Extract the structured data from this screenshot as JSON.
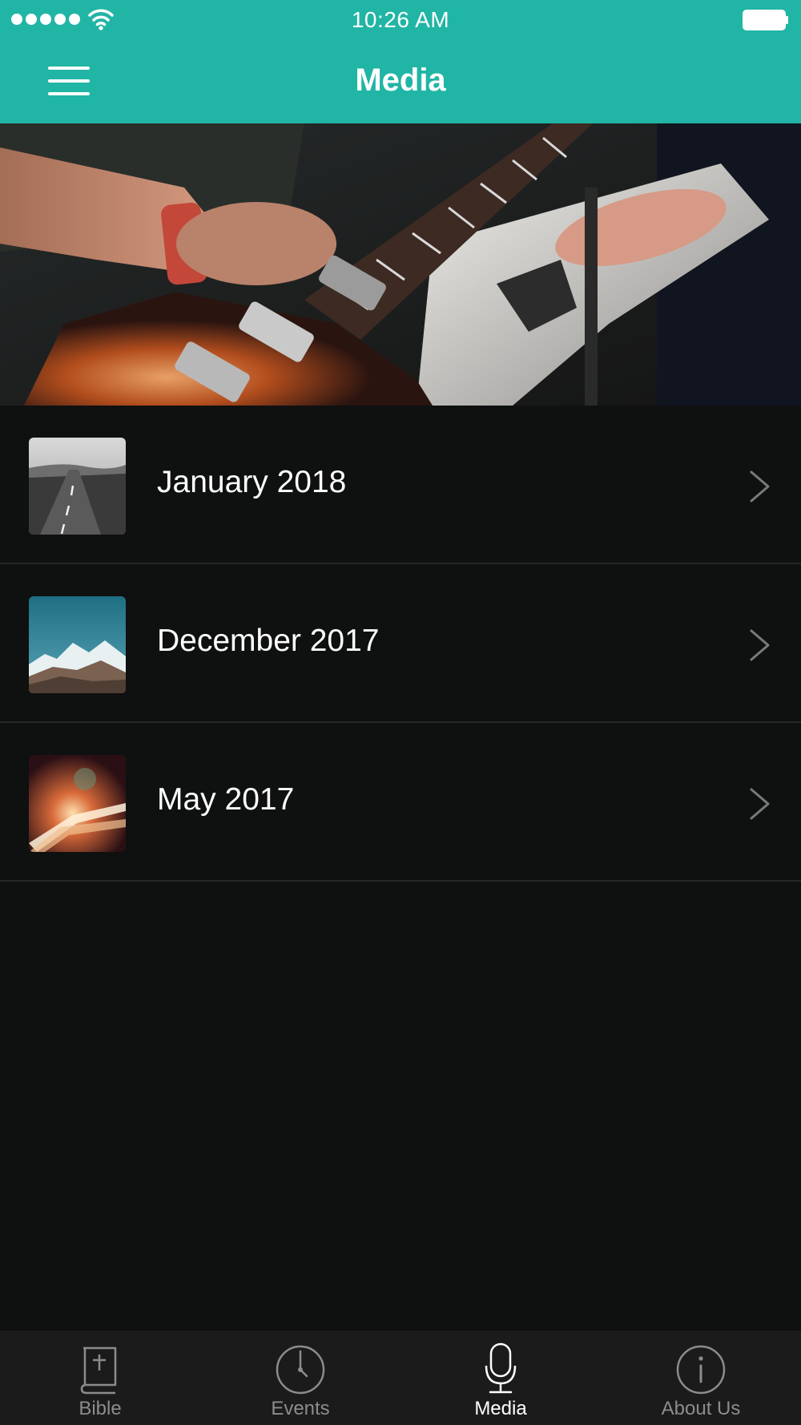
{
  "status_bar": {
    "time": "10:26 AM",
    "signal_icon": "signal-dots-icon",
    "wifi_icon": "wifi-icon",
    "battery_icon": "battery-icon"
  },
  "nav": {
    "title": "Media",
    "menu_icon": "hamburger-menu-icon"
  },
  "hero": {
    "image": "guitarists-hero-image"
  },
  "media_items": [
    {
      "label": "January 2018",
      "thumbnail": "road-landscape-thumbnail"
    },
    {
      "label": "December 2017",
      "thumbnail": "mountains-thumbnail"
    },
    {
      "label": "May 2017",
      "thumbnail": "highway-lights-thumbnail"
    }
  ],
  "tab_bar": {
    "tabs": [
      {
        "label": "Bible",
        "icon": "bible-icon",
        "active": false
      },
      {
        "label": "Events",
        "icon": "clock-icon",
        "active": false
      },
      {
        "label": "Media",
        "icon": "microphone-icon",
        "active": true
      },
      {
        "label": "About Us",
        "icon": "info-icon",
        "active": false
      }
    ]
  },
  "colors": {
    "accent": "#21b5a5",
    "background": "#0f1010",
    "tab_bar": "#1b1b1b",
    "tab_inactive": "#8c8c8c",
    "tab_active": "#ffffff"
  }
}
